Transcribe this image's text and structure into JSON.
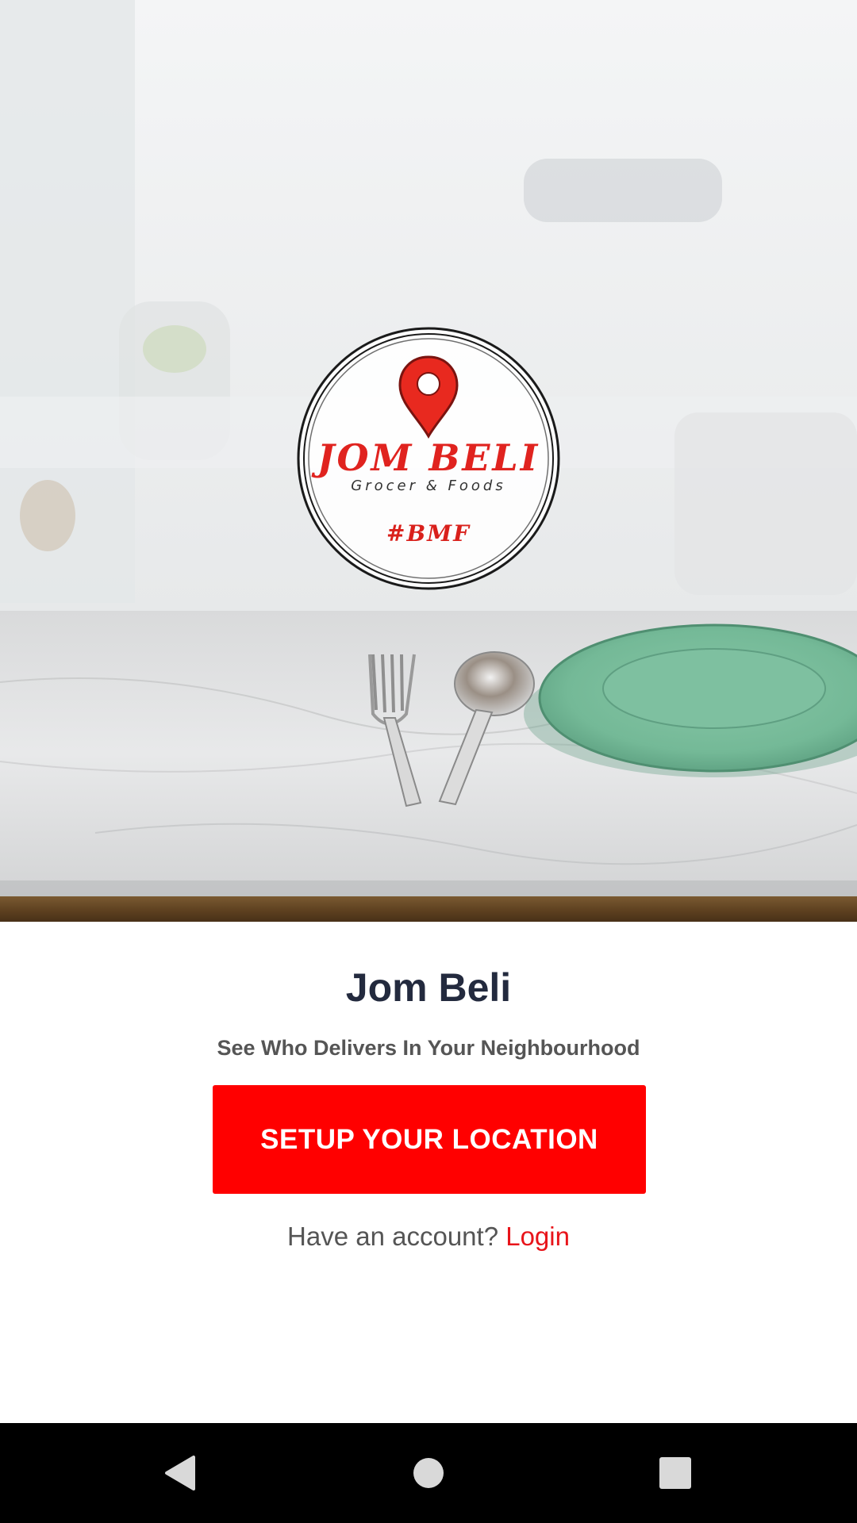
{
  "hero": {
    "logo": {
      "title": "JOM BELI",
      "subtitle": "Grocer & Foods",
      "tag": "#BMF",
      "icon": "location-pin-icon",
      "pin_color": "#e8291f"
    }
  },
  "main": {
    "title": "Jom Beli",
    "subtitle": "See Who Delivers In Your Neighbourhood",
    "cta_label": "SETUP YOUR LOCATION",
    "cta_color": "#ff0000",
    "login_prompt": "Have an account?",
    "login_label": "Login",
    "login_color": "#e8141a"
  },
  "navbar": {
    "back_icon": "back-triangle-icon",
    "home_icon": "home-circle-icon",
    "recents_icon": "recents-square-icon"
  }
}
